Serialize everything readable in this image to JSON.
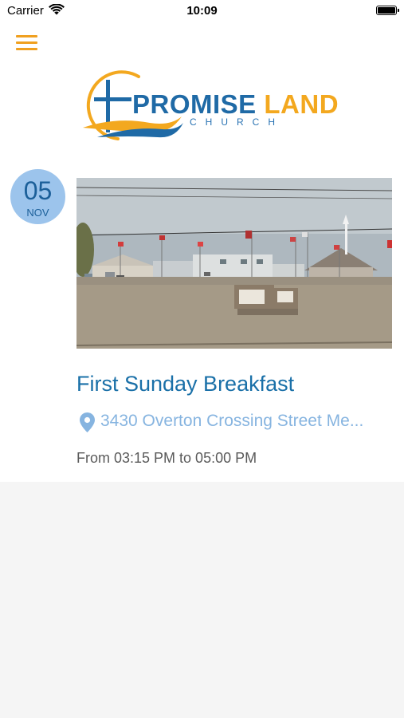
{
  "status_bar": {
    "carrier": "Carrier",
    "time": "10:09"
  },
  "header": {
    "menu_icon": "hamburger-menu-icon",
    "accent_color": "#f0a020"
  },
  "logo": {
    "word1": "PROMISE",
    "word2": "LAND",
    "subtitle": "CHURCH"
  },
  "event": {
    "day": "05",
    "month": "NOV",
    "title": "First Sunday Breakfast",
    "location": "3430 Overton Crossing Street Me...",
    "time": "From 03:15 PM to 05:00 PM",
    "location_icon": "location-pin-icon",
    "title_color": "#1a70a8",
    "badge_color": "#9cc4ec"
  }
}
